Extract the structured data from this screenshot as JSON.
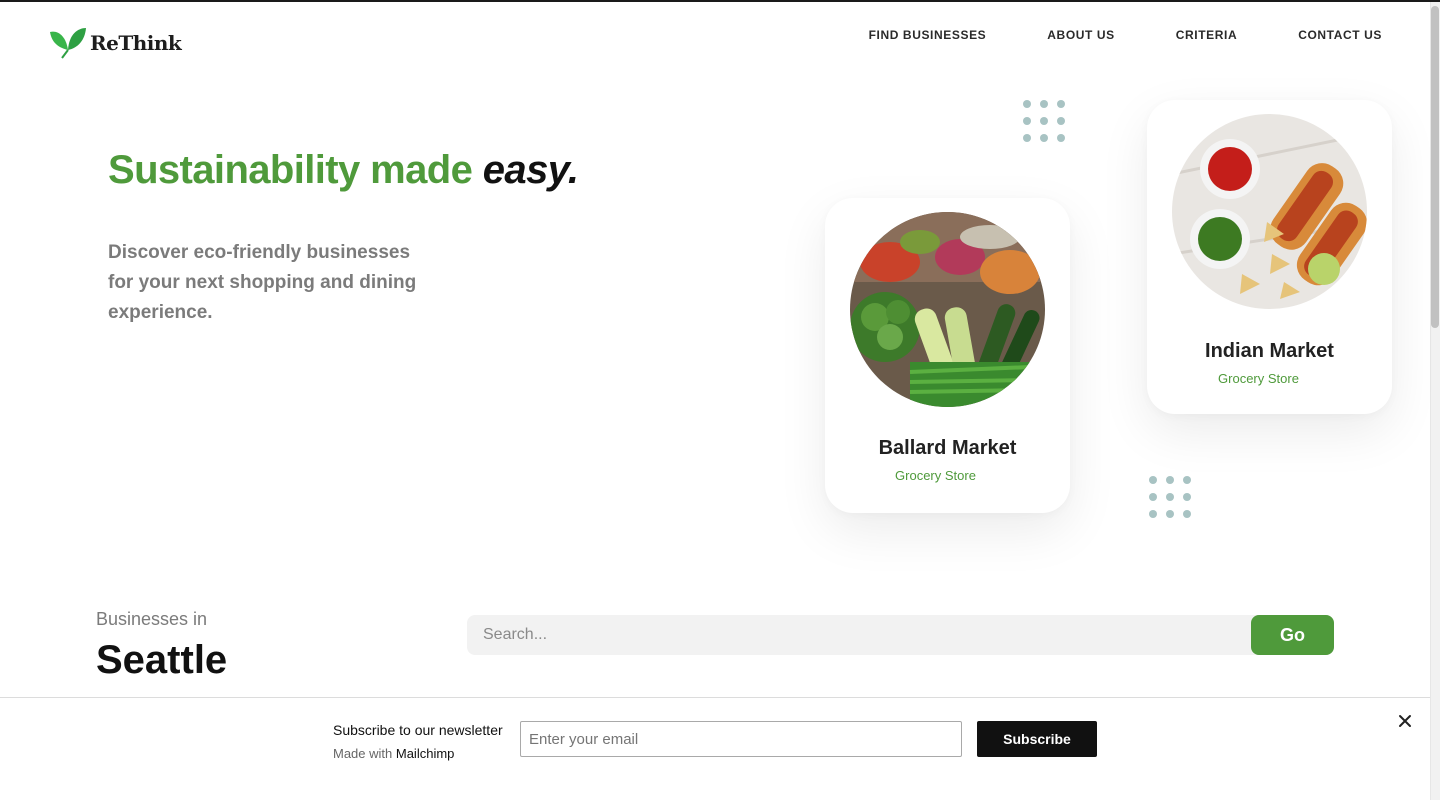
{
  "header": {
    "logo_text": "ReThink",
    "nav": [
      "FIND BUSINESSES",
      "ABOUT US",
      "CRITERIA",
      "CONTACT US"
    ]
  },
  "hero": {
    "title_green": "Sustainability made",
    "title_dark": "easy.",
    "subtitle": "Discover eco-friendly businesses for your next shopping and dining experience."
  },
  "cards": [
    {
      "name": "Ballard Market",
      "category": "Grocery Store",
      "image": "vegetables-photo"
    },
    {
      "name": "Indian Market",
      "category": "Grocery Store",
      "image": "food-platter-photo"
    }
  ],
  "businesses": {
    "label": "Businesses in",
    "city": "Seattle",
    "search_placeholder": "Search...",
    "go_label": "Go"
  },
  "newsletter": {
    "title": "Subscribe to our newsletter",
    "made_with_prefix": "Made with ",
    "made_with_brand": "Mailchimp",
    "email_placeholder": "Enter your email",
    "subscribe_label": "Subscribe"
  },
  "colors": {
    "brand_green": "#4f9a3b",
    "dot_color": "#a8c3c3"
  }
}
